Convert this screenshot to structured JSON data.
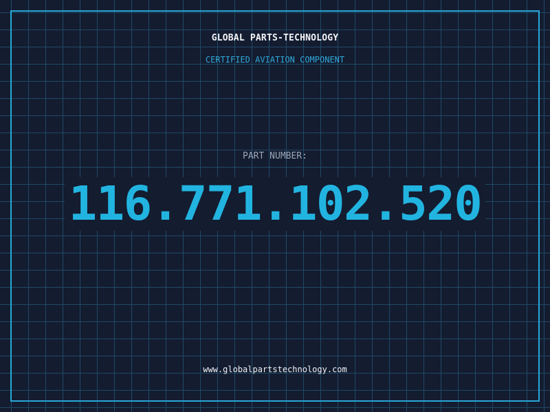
{
  "header": {
    "brand": "GLOBAL PARTS-TECHNOLOGY",
    "subtitle": "CERTIFIED AVIATION COMPONENT"
  },
  "part": {
    "label": "PART NUMBER:",
    "number": "116.771.102.520"
  },
  "footer": {
    "url": "www.globalpartstechnology.com"
  },
  "colors": {
    "background": "#141c30",
    "grid": "#1f4a66",
    "accent": "#22b4e0",
    "text": "#f2f4f8"
  }
}
